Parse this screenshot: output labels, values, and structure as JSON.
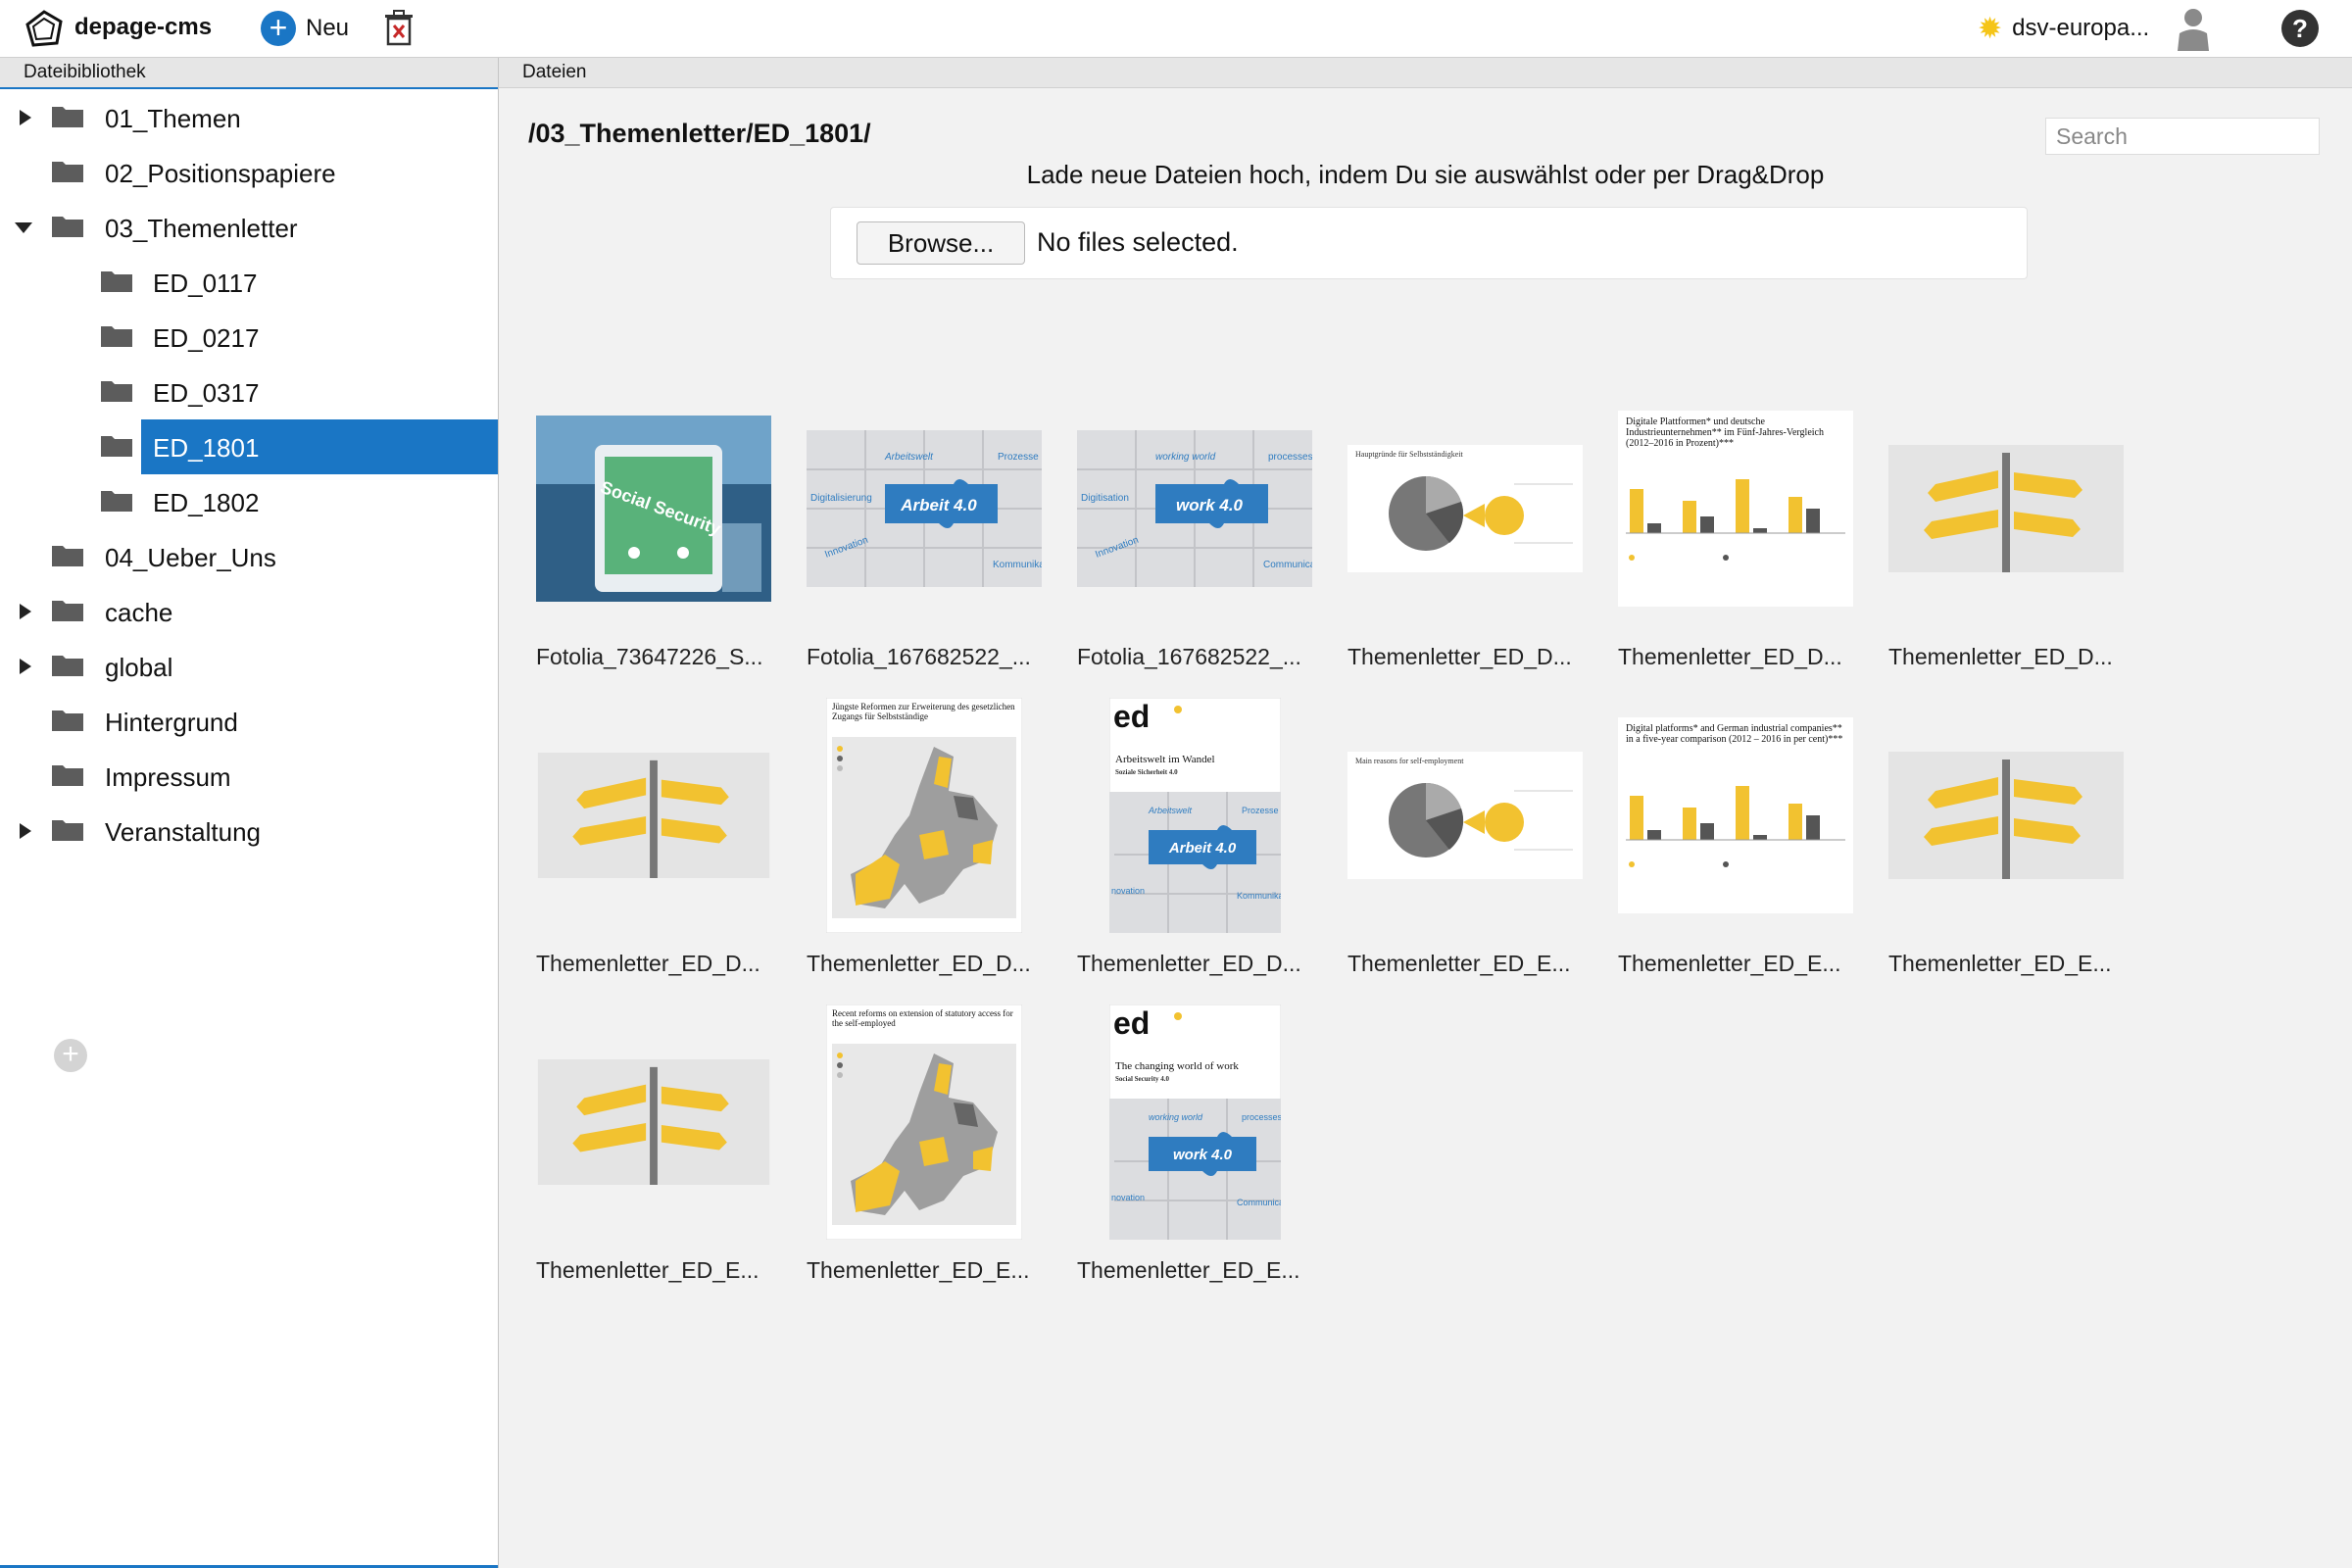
{
  "toolbar": {
    "app_title": "depage-cms",
    "new_label": "Neu",
    "project_name": "dsv-europa..."
  },
  "sidebar": {
    "header": "Dateibibliothek",
    "items": [
      {
        "label": "01_Themen"
      },
      {
        "label": "02_Positionspapiere"
      },
      {
        "label": "03_Themenletter"
      },
      {
        "label": "ED_0117"
      },
      {
        "label": "ED_0217"
      },
      {
        "label": "ED_0317"
      },
      {
        "label": "ED_1801"
      },
      {
        "label": "ED_1802"
      },
      {
        "label": "04_Ueber_Uns"
      },
      {
        "label": "cache"
      },
      {
        "label": "global"
      },
      {
        "label": "Hintergrund"
      },
      {
        "label": "Impressum"
      },
      {
        "label": "Veranstaltung"
      }
    ],
    "selected": "ED_1801"
  },
  "main": {
    "header": "Dateien",
    "path": "/03_Themenletter/ED_1801/",
    "search_placeholder": "Search",
    "upload_hint": "Lade neue Dateien hoch, indem Du sie auswählst oder per Drag&Drop",
    "browse_label": "Browse...",
    "no_files_label": "No files selected.",
    "files": [
      {
        "caption": "Fotolia_73647226_S..."
      },
      {
        "caption": "Fotolia_167682522_..."
      },
      {
        "caption": "Fotolia_167682522_..."
      },
      {
        "caption": "Themenletter_ED_D..."
      },
      {
        "caption": "Themenletter_ED_D..."
      },
      {
        "caption": "Themenletter_ED_D..."
      },
      {
        "caption": "Themenletter_ED_D..."
      },
      {
        "caption": "Themenletter_ED_D..."
      },
      {
        "caption": "Themenletter_ED_D..."
      },
      {
        "caption": "Themenletter_ED_E..."
      },
      {
        "caption": "Themenletter_ED_E..."
      },
      {
        "caption": "Themenletter_ED_E..."
      },
      {
        "caption": "Themenletter_ED_E..."
      },
      {
        "caption": "Themenletter_ED_E..."
      },
      {
        "caption": "Themenletter_ED_E..."
      }
    ],
    "thumb_text": {
      "social": "Social Security",
      "puzzle1": [
        "Arbeitswelt",
        "Digitalisierung",
        "Arbeit 4.0",
        "Innovation",
        "Prozesse",
        "Kommunika"
      ],
      "puzzle2": [
        "working world",
        "Digitisation",
        "work 4.0",
        "Innovation",
        "processes",
        "Communica"
      ],
      "chart_de_title": "Hauptgründe für Selbstständigkeit",
      "bar_de_title": "Digitale Plattformen* und deutsche Industrieunternehmen** im Fünf-Jahres-Vergleich (2012–2016 in Prozent)***",
      "map_de_title": "Jüngste Reformen zur Erweiterung des gesetzlichen Zugangs für Selbstständige",
      "cover_de_title": "Arbeitswelt im Wandel",
      "cover_de_sub": "Soziale Sicherheit 4.0",
      "chart_en_title": "Main reasons for self-employment",
      "bar_en_title": "Digital platforms* and German industrial companies** in a five-year comparison (2012 – 2016 in per cent)***",
      "map_en_title": "Recent reforms on extension of statutory access for the self-employed",
      "cover_en_title": "The changing world of work",
      "cover_en_sub": "Social Security 4.0",
      "ed_logo": "ed",
      "puzzle_cover_de": [
        "Arbeitswelt",
        "Arbeit 4.0",
        "Prozesse",
        "Kommunika",
        "novation"
      ],
      "puzzle_cover_en": [
        "working world",
        "work 4.0",
        "processes",
        "Communica",
        "novation"
      ]
    }
  }
}
